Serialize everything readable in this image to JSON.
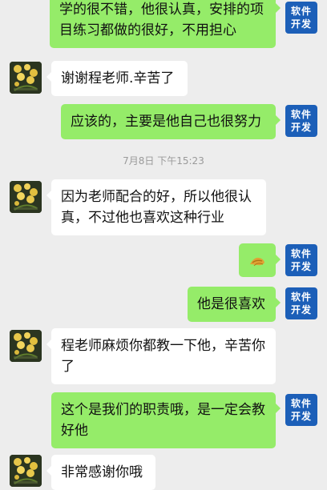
{
  "self_avatar": {
    "line1": "软件",
    "line2": "开发",
    "color": "#1c5fb8"
  },
  "messages": [
    {
      "side": "out",
      "text": "学的很不错，他很认真，安排的项目练习都做的很好，不用担心"
    },
    {
      "side": "in",
      "text": "谢谢程老师.辛苦了"
    },
    {
      "side": "out",
      "text": "应该的，主要是他自己也很努力"
    },
    {
      "side": "in",
      "text": "因为老师配合的好，所以他很认真，不过他也喜欢这种行业"
    },
    {
      "side": "out",
      "emoji": "bean-icon"
    },
    {
      "side": "out",
      "text": "他是很喜欢"
    },
    {
      "side": "in",
      "text": "程老师麻烦你都教一下他，辛苦你了"
    },
    {
      "side": "out",
      "text": "这个是我们的职责哦，是一定会教好他"
    },
    {
      "side": "in",
      "text": "非常感谢你哦"
    }
  ],
  "timestamp": "7月8日 下午15:23",
  "colors": {
    "background": "#ededed",
    "incoming": "#ffffff",
    "outgoing": "#95ec69"
  }
}
